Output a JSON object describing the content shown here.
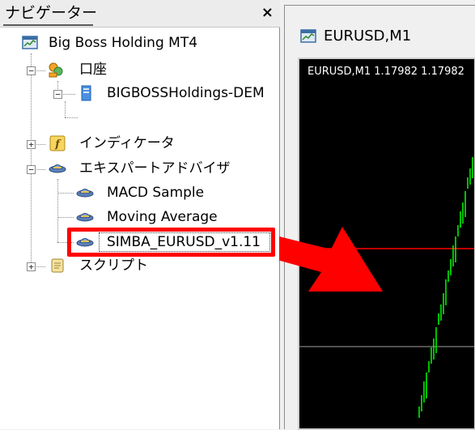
{
  "navigator": {
    "title": "ナビゲーター",
    "close_label": "×",
    "tree": {
      "root_label": "Big Boss Holding MT4",
      "accounts_label": "口座",
      "account_server_label": "BIGBOSSHoldings-DEM",
      "indicators_label": "インディケータ",
      "experts_label": "エキスパートアドバイザ",
      "experts": [
        {
          "label": "MACD Sample"
        },
        {
          "label": "Moving Average"
        },
        {
          "label": "SIMBA_EURUSD_v1.11"
        }
      ],
      "scripts_label": "スクリプト",
      "expander_collapsed": "+",
      "expander_expanded": "−"
    }
  },
  "chart": {
    "window_title": "EURUSD,M1",
    "info_text": "EURUSD,M1  1.17982 1.17982"
  },
  "colors": {
    "highlight": "#ff0000",
    "candle": "#00ff00",
    "price_line": "#ff0000",
    "chart_bg": "#000000"
  }
}
